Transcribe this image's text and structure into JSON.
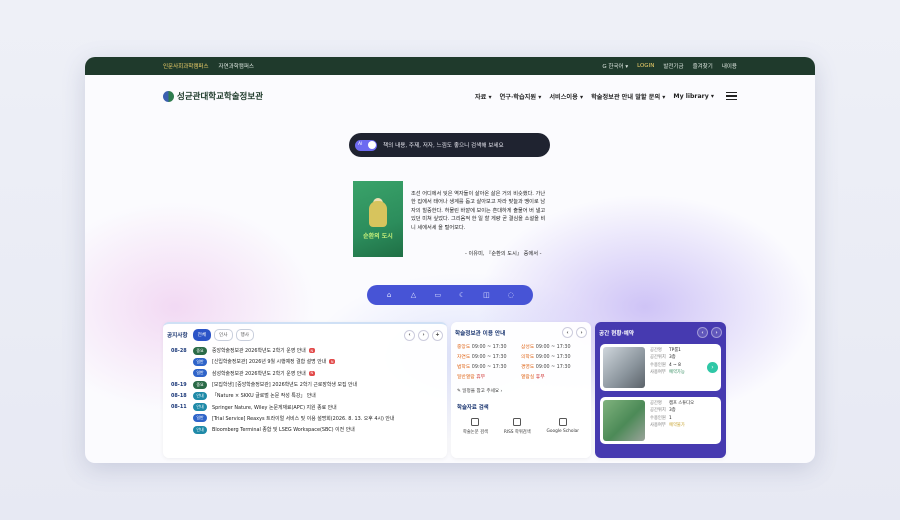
{
  "topbar": {
    "campus_1": "인문사회과학캠퍼스",
    "campus_2": "자연과학캠퍼스",
    "language": "G 한국어 ▾",
    "login": "LOGIN",
    "link_1": "발전기금",
    "link_2": "즐겨찾기",
    "link_3": "내이용"
  },
  "header": {
    "logo_text": "성균관대학교학술정보관",
    "nav": [
      "자료 ▾",
      "연구·학습지원 ▾",
      "서비스이용 ▾",
      "학술정보관 안내 말할 문의 ▾",
      "My library ▾"
    ]
  },
  "search": {
    "toggle_label": "AI",
    "placeholder": "책의 내용, 주제, 저자, 느낌도 좋으니 검색해 보세요"
  },
  "featured": {
    "book_title": "순환의 도시",
    "quote": "조선 어디에서 잊은 역자들이 살아온 삶은 거의 비슷했다. 가난한 집에서 태어나 생계를 돕고 살아보고 자라 맞늘과 땡이로 남자의 힐중한다. 허물린 바깥에 보이는 흔대하게 출물어 버 낼고 있던 미쳐 싶었다. 그리움적 한 일 할 게량 곧 결심을 소설을 비니 세에서세 을 털어모다.",
    "source": "- 이유미, 『순환의 도시』 중에서 -"
  },
  "icon_bar": [
    "home-icon",
    "alert-icon",
    "book-icon",
    "moon-icon",
    "bookmark-icon",
    "chat-icon"
  ],
  "notices": {
    "title": "공지사항",
    "tabs": [
      "전체",
      "인사",
      "행사"
    ],
    "pager": [
      "‹",
      "›",
      "+"
    ],
    "rows": [
      {
        "date": "08-28",
        "badge": "중요",
        "badge_color": "#2a6a47",
        "text": "중앙학술정보관 2026학년도 2학기 운영 안내",
        "new": "N"
      },
      {
        "date": "",
        "badge": "일반",
        "badge_color": "#2f64c9",
        "text": "[신입학술정보관] 2026년 9월 시행예정 결합 설명 안내",
        "new": "N"
      },
      {
        "date": "",
        "badge": "일반",
        "badge_color": "#2f64c9",
        "text": "삼성학술정보관 2026학년도 2학기 운영 안내",
        "new": "N"
      },
      {
        "date": "08-19",
        "badge": "중요",
        "badge_color": "#2a6a47",
        "text": "[모집학생] [중앙학술정보관] 2026학년도 2학기 근로장학생 모집 안내",
        "new": ""
      },
      {
        "date": "08-18",
        "badge": "안내",
        "badge_color": "#1f8aa8",
        "text": "「Nature × SKKU 글로벌 논문 작성 특강」 안내",
        "new": ""
      },
      {
        "date": "08-11",
        "badge": "안내",
        "badge_color": "#1f8aa8",
        "text": "Springer Nature, Wiley 논문게재료(APC) 지원 종료 안내",
        "new": ""
      },
      {
        "date": "",
        "badge": "일반",
        "badge_color": "#2f64c9",
        "text": "[Trial Service] Reaxys 트라이얼 서비스 및 이용 설명회(2026. 8. 13. 오후 4시) 안내",
        "new": ""
      },
      {
        "date": "",
        "badge": "안내",
        "badge_color": "#1f8aa8",
        "text": "Bloomberg Terminal 종합 및 LSEG Workspace(SBC) 이전 안내",
        "new": ""
      }
    ]
  },
  "hours": {
    "title": "학술정보관 이용 안내",
    "pager": [
      "‹",
      "›"
    ],
    "rows": [
      {
        "k": "중앙도",
        "v": "09:00 ~ 17:30",
        "k2": "삼성도",
        "v2": "09:00 ~ 17:30"
      },
      {
        "k": "자연도",
        "v": "09:00 ~ 17:30",
        "k2": "의학도",
        "v2": "09:00 ~ 17:30"
      },
      {
        "k": "법학도",
        "v": "09:00 ~ 17:30",
        "k2": "경영도",
        "v2": "09:00 ~ 17:30"
      },
      {
        "k": "일반열람",
        "v": "휴무",
        "k2": "열람실",
        "v2": "휴무"
      }
    ],
    "note": "✎ 일정을 참고 주세요 ›",
    "tools_title": "학술자료 검색",
    "tools": [
      "학술논문 검색",
      "RISS 학위검색",
      "Google Scholar"
    ]
  },
  "rooms": {
    "title": "공간 현황·예약",
    "pager": [
      "‹",
      "›"
    ],
    "items": [
      {
        "name": "TP룸1",
        "floor": "3층",
        "capacity": "4 ~ 8",
        "status": "예약가능",
        "available": true,
        "k1": "공간명",
        "k2": "공간위치",
        "k3": "수용인원",
        "k4": "사용여부"
      },
      {
        "name": "캠프 스튜디오",
        "floor": "3층",
        "capacity": "1",
        "status": "예약불가",
        "available": false,
        "k1": "공간명",
        "k2": "공간위치",
        "k3": "수용인원",
        "k4": "사용여부"
      }
    ]
  }
}
